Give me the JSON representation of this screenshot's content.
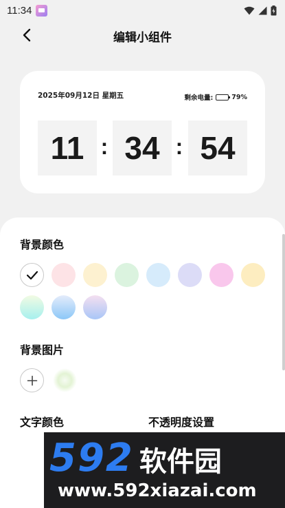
{
  "status_bar": {
    "time": "11:34",
    "icons": [
      "notification-app-icon",
      "wifi-icon",
      "signal-icon",
      "battery-charging-icon"
    ]
  },
  "header": {
    "title": "编辑小组件",
    "back_icon": "chevron-left-icon"
  },
  "widget": {
    "date": "2025年09月12日 星期五",
    "battery_label": "剩余电量:",
    "battery_percent": "79%",
    "battery_level": 0.79,
    "hours": "11",
    "minutes": "34",
    "seconds": "54",
    "separator": ":"
  },
  "background_color": {
    "title": "背景颜色",
    "selected_icon": "check-icon",
    "swatches": [
      "#fde3e6",
      "#fdf1d0",
      "#dbf3df",
      "#d6ebfb",
      "#dcdcf7",
      "#f9c7ec",
      "#fdedc0"
    ],
    "gradient_swatches": [
      [
        "#f2fbe3",
        "#a6f0ee"
      ],
      [
        "#e4ecfb",
        "#8cc7f7"
      ],
      [
        "#f4dff0",
        "#a9c6f7"
      ]
    ]
  },
  "background_image": {
    "title": "背景图片",
    "add_icon": "plus-icon"
  },
  "text_color": {
    "title": "文字颜色"
  },
  "opacity": {
    "title": "不透明度设置"
  },
  "watermark": {
    "brand_number": "592",
    "brand_text": "软件园",
    "url": "www.592xiazai.com",
    "brand_color": "#2d7cf0"
  }
}
